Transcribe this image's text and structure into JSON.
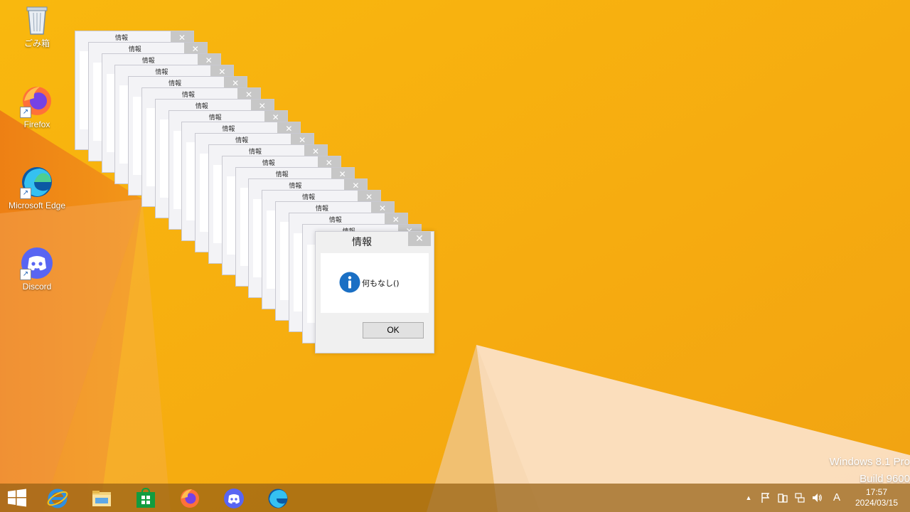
{
  "desktop": {
    "icons": [
      {
        "label": "ごみ箱",
        "icon": "recycle-bin-icon"
      },
      {
        "label": "Firefox",
        "icon": "firefox-icon"
      },
      {
        "label": "Microsoft Edge",
        "icon": "edge-icon"
      },
      {
        "label": "Discord",
        "icon": "discord-icon"
      }
    ],
    "watermark": {
      "line1": "Windows 8.1 Pro",
      "line2": "Build 9600"
    }
  },
  "stacked_dialogs": {
    "title": "情報",
    "count": 18
  },
  "dialog": {
    "title": "情報",
    "close_glyph": "✕",
    "message": "何もなし()",
    "ok_label": "OK",
    "icon": "information-icon"
  },
  "taskbar": {
    "apps": [
      "start-button",
      "internet-explorer",
      "file-explorer",
      "store",
      "firefox",
      "discord",
      "edge"
    ],
    "tray": {
      "overflow": "▲",
      "ime_mode": "A",
      "time": "17:57",
      "date": "2024/03/15"
    }
  },
  "colors": {
    "wallpaper": "#f7b10e",
    "accent_info": "#1a6fc4",
    "taskbar": "#9a6317"
  }
}
